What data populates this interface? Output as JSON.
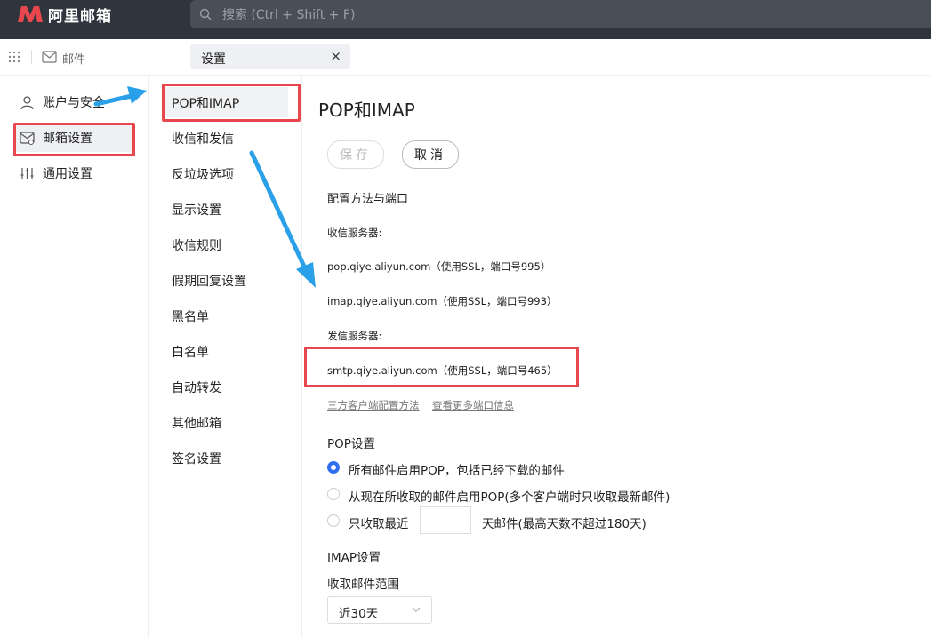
{
  "app": {
    "logo_text": "阿里邮箱"
  },
  "search": {
    "placeholder": "搜索 (Ctrl + Shift + F)"
  },
  "subbar": {
    "mail_label": "邮件",
    "tab_label": "设置",
    "tab_close": "×"
  },
  "left_nav": {
    "items": [
      {
        "label": "账户与安全",
        "icon": "user-icon"
      },
      {
        "label": "邮箱设置",
        "icon": "mailbox-settings-icon",
        "active": true
      },
      {
        "label": "通用设置",
        "icon": "sliders-icon"
      }
    ]
  },
  "sub_nav": {
    "items": [
      {
        "label": "POP和IMAP",
        "active": true
      },
      {
        "label": "收信和发信"
      },
      {
        "label": "反垃圾选项"
      },
      {
        "label": "显示设置"
      },
      {
        "label": "收信规则"
      },
      {
        "label": "假期回复设置"
      },
      {
        "label": "黑名单"
      },
      {
        "label": "白名单"
      },
      {
        "label": "自动转发"
      },
      {
        "label": "其他邮箱"
      },
      {
        "label": "签名设置"
      }
    ]
  },
  "main": {
    "title": "POP和IMAP",
    "save_label": "保存",
    "cancel_label": "取消",
    "config_heading": "配置方法与端口",
    "incoming_heading": "收信服务器:",
    "pop_server": "pop.qiye.aliyun.com（使用SSL，端口号995）",
    "imap_server": "imap.qiye.aliyun.com（使用SSL，端口号993）",
    "outgoing_heading": "发信服务器:",
    "smtp_server": "smtp.qiye.aliyun.com（使用SSL，端口号465）",
    "link_client_config": "三方客户端配置方法",
    "link_more_ports": "查看更多端口信息",
    "pop_settings_heading": "POP设置",
    "pop_options": [
      {
        "label": "所有邮件启用POP，包括已经下载的邮件",
        "selected": true
      },
      {
        "label": "从现在所收取的邮件启用POP(多个客户端时只收取最新邮件)",
        "selected": false
      },
      {
        "label": "只收取最近",
        "selected": false
      }
    ],
    "days_input_value": "",
    "days_suffix": "天邮件(最高天数不超过180天)",
    "imap_settings_heading": "IMAP设置",
    "imap_range_label": "收取邮件范围",
    "imap_range_value": "近30天"
  },
  "colors": {
    "topbar": "#30353d",
    "brand_red": "#e8474d",
    "radio_blue": "#2f6ff0",
    "annotation_red": "#e8474d",
    "annotation_blue": "#2aa0e8"
  }
}
